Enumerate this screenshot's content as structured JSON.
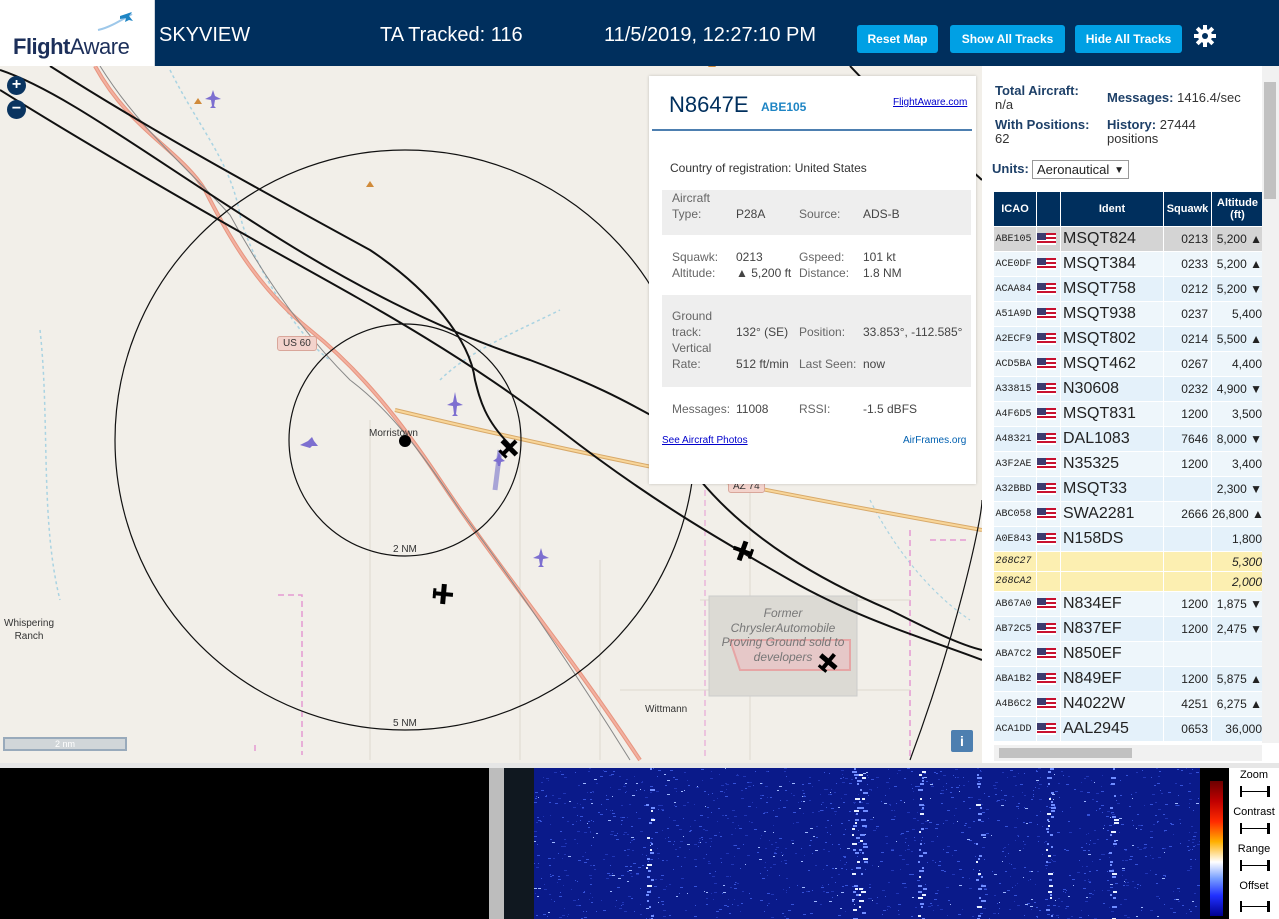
{
  "header": {
    "logo_text_1": "Flight",
    "logo_text_2": "Aware",
    "app_title": "SKYVIEW",
    "tracked": "TA Tracked: 116",
    "datetime": "11/5/2019, 12:27:10 PM",
    "reset_map": "Reset Map",
    "show_all": "Show All Tracks",
    "hide_all": "Hide All Tracks",
    "settings_icon": "gear-icon"
  },
  "map": {
    "zoom_in": "+",
    "zoom_out": "−",
    "scale_label": "2 nm",
    "info_button": "i",
    "labels": {
      "whispering_1": "Whispering",
      "whispering_2": "Ranch",
      "morristown": "Morristown",
      "wittmann": "Wittmann",
      "ring_2nm": "2 NM",
      "ring_5nm": "5 NM",
      "us60": "US 60",
      "az74": "AZ 74",
      "former": "Former ChryslerAutomobile Proving Ground sold to developers"
    }
  },
  "popup": {
    "registration": "N8647E",
    "callsign": "ABE105",
    "fa_link": "FlightAware.com",
    "country_label": "Country of registration:",
    "country": "United States",
    "aircraft_label_1": "Aircraft",
    "type_label": "Type:",
    "type": "P28A",
    "source_label": "Source:",
    "source": "ADS-B",
    "squawk_label": "Squawk:",
    "squawk": "0213",
    "gspeed_label": "Gspeed:",
    "gspeed": "101 kt",
    "altitude_label": "Altitude:",
    "altitude": "▲ 5,200 ft",
    "distance_label": "Distance:",
    "distance": "1.8 NM",
    "ground_label_1": "Ground",
    "ground_label_2": "track:",
    "track": "132° (SE)",
    "position_label": "Position:",
    "position": "33.853°, -112.585°",
    "vertical_label_1": "Vertical",
    "vertical_label_2": "Rate:",
    "vrate": "512 ft/min",
    "lastseen_label": "Last Seen:",
    "lastseen": "now",
    "messages_label": "Messages:",
    "messages": "11008",
    "rssi_label": "RSSI:",
    "rssi": "-1.5 dBFS",
    "photos_link": "See Aircraft Photos",
    "airframes_link": "AirFrames.org"
  },
  "panel": {
    "total_label": "Total Aircraft:",
    "total_value": "n/a",
    "messages_label": "Messages:",
    "messages_value": "1416.4/sec",
    "positions_label": "With Positions:",
    "positions_value": "62",
    "history_label": "History:",
    "history_value": "27444",
    "history_unit": "positions",
    "units_label": "Units:",
    "units_value": "Aeronautical"
  },
  "table": {
    "headers": {
      "icao": "ICAO",
      "ident": "Ident",
      "squawk": "Squawk",
      "altitude_1": "Altitude",
      "altitude_2": "(ft)"
    },
    "rows": [
      {
        "icao": "ABE105",
        "flag": true,
        "ident": "MSQT824",
        "squawk": "0213",
        "alt": "5,200 ▲"
      },
      {
        "icao": "ACE0DF",
        "flag": true,
        "ident": "MSQT384",
        "squawk": "0233",
        "alt": "5,200 ▲"
      },
      {
        "icao": "ACAA84",
        "flag": true,
        "ident": "MSQT758",
        "squawk": "0212",
        "alt": "5,200 ▼"
      },
      {
        "icao": "A51A9D",
        "flag": true,
        "ident": "MSQT938",
        "squawk": "0237",
        "alt": "5,400"
      },
      {
        "icao": "A2ECF9",
        "flag": true,
        "ident": "MSQT802",
        "squawk": "0214",
        "alt": "5,500 ▲"
      },
      {
        "icao": "ACD5BA",
        "flag": true,
        "ident": "MSQT462",
        "squawk": "0267",
        "alt": "4,400"
      },
      {
        "icao": "A33815",
        "flag": true,
        "ident": "N30608",
        "squawk": "0232",
        "alt": "4,900 ▼"
      },
      {
        "icao": "A4F6D5",
        "flag": true,
        "ident": "MSQT831",
        "squawk": "1200",
        "alt": "3,500"
      },
      {
        "icao": "A48321",
        "flag": true,
        "ident": "DAL1083",
        "squawk": "7646",
        "alt": "8,000 ▼"
      },
      {
        "icao": "A3F2AE",
        "flag": true,
        "ident": "N35325",
        "squawk": "1200",
        "alt": "3,400"
      },
      {
        "icao": "A32BBD",
        "flag": true,
        "ident": "MSQT33",
        "squawk": "",
        "alt": "2,300 ▼"
      },
      {
        "icao": "ABC058",
        "flag": true,
        "ident": "SWA2281",
        "squawk": "2666",
        "alt": "26,800 ▲"
      },
      {
        "icao": "A0E843",
        "flag": true,
        "ident": "N158DS",
        "squawk": "",
        "alt": "1,800"
      },
      {
        "icao": "268C27",
        "flag": false,
        "ident": "",
        "squawk": "",
        "alt": "5,300"
      },
      {
        "icao": "268CA2",
        "flag": false,
        "ident": "",
        "squawk": "",
        "alt": "2,000"
      },
      {
        "icao": "AB67A0",
        "flag": true,
        "ident": "N834EF",
        "squawk": "1200",
        "alt": "1,875 ▼"
      },
      {
        "icao": "AB72C5",
        "flag": true,
        "ident": "N837EF",
        "squawk": "1200",
        "alt": "2,475 ▼"
      },
      {
        "icao": "ABA7C2",
        "flag": true,
        "ident": "N850EF",
        "squawk": "",
        "alt": ""
      },
      {
        "icao": "ABA1B2",
        "flag": true,
        "ident": "N849EF",
        "squawk": "1200",
        "alt": "5,875 ▲"
      },
      {
        "icao": "A4B6C2",
        "flag": true,
        "ident": "N4022W",
        "squawk": "4251",
        "alt": "6,275 ▲"
      },
      {
        "icao": "ACA1DD",
        "flag": true,
        "ident": "AAL2945",
        "squawk": "0653",
        "alt": "36,000"
      }
    ]
  },
  "waterfall": {
    "zoom": "Zoom",
    "contrast": "Contrast",
    "range": "Range",
    "offset": "Offset"
  },
  "colors": {
    "header_bg": "#002f5d",
    "button": "#00a0e4",
    "selected_row": "#d4d4d4",
    "yellow_row": "#fcefb1"
  }
}
